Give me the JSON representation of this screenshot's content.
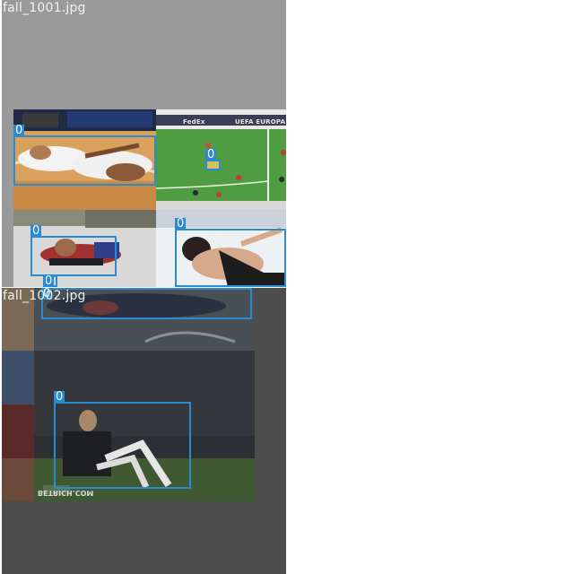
{
  "tiles": [
    {
      "filename": "fall_1001.jpg",
      "detections": [
        {
          "class_label": "0"
        },
        {
          "class_label": "0"
        },
        {
          "class_label": "0"
        },
        {
          "class_label": "0"
        },
        {
          "class_label": "0"
        }
      ],
      "banner_text": "UEFA EUROPA LE",
      "sponsor_text": "FedEx"
    },
    {
      "filename": "fall_1002.jpg",
      "detections": [
        {
          "class_label": "0"
        },
        {
          "class_label": "0"
        }
      ],
      "watermark_text": "BETRICH.COM"
    }
  ],
  "colors": {
    "box_border": "#2b8bd1",
    "tile_a_bg": "#9a9a9a",
    "tile_b_bg": "#4d4d4d",
    "page_bg": "#ffffff"
  }
}
